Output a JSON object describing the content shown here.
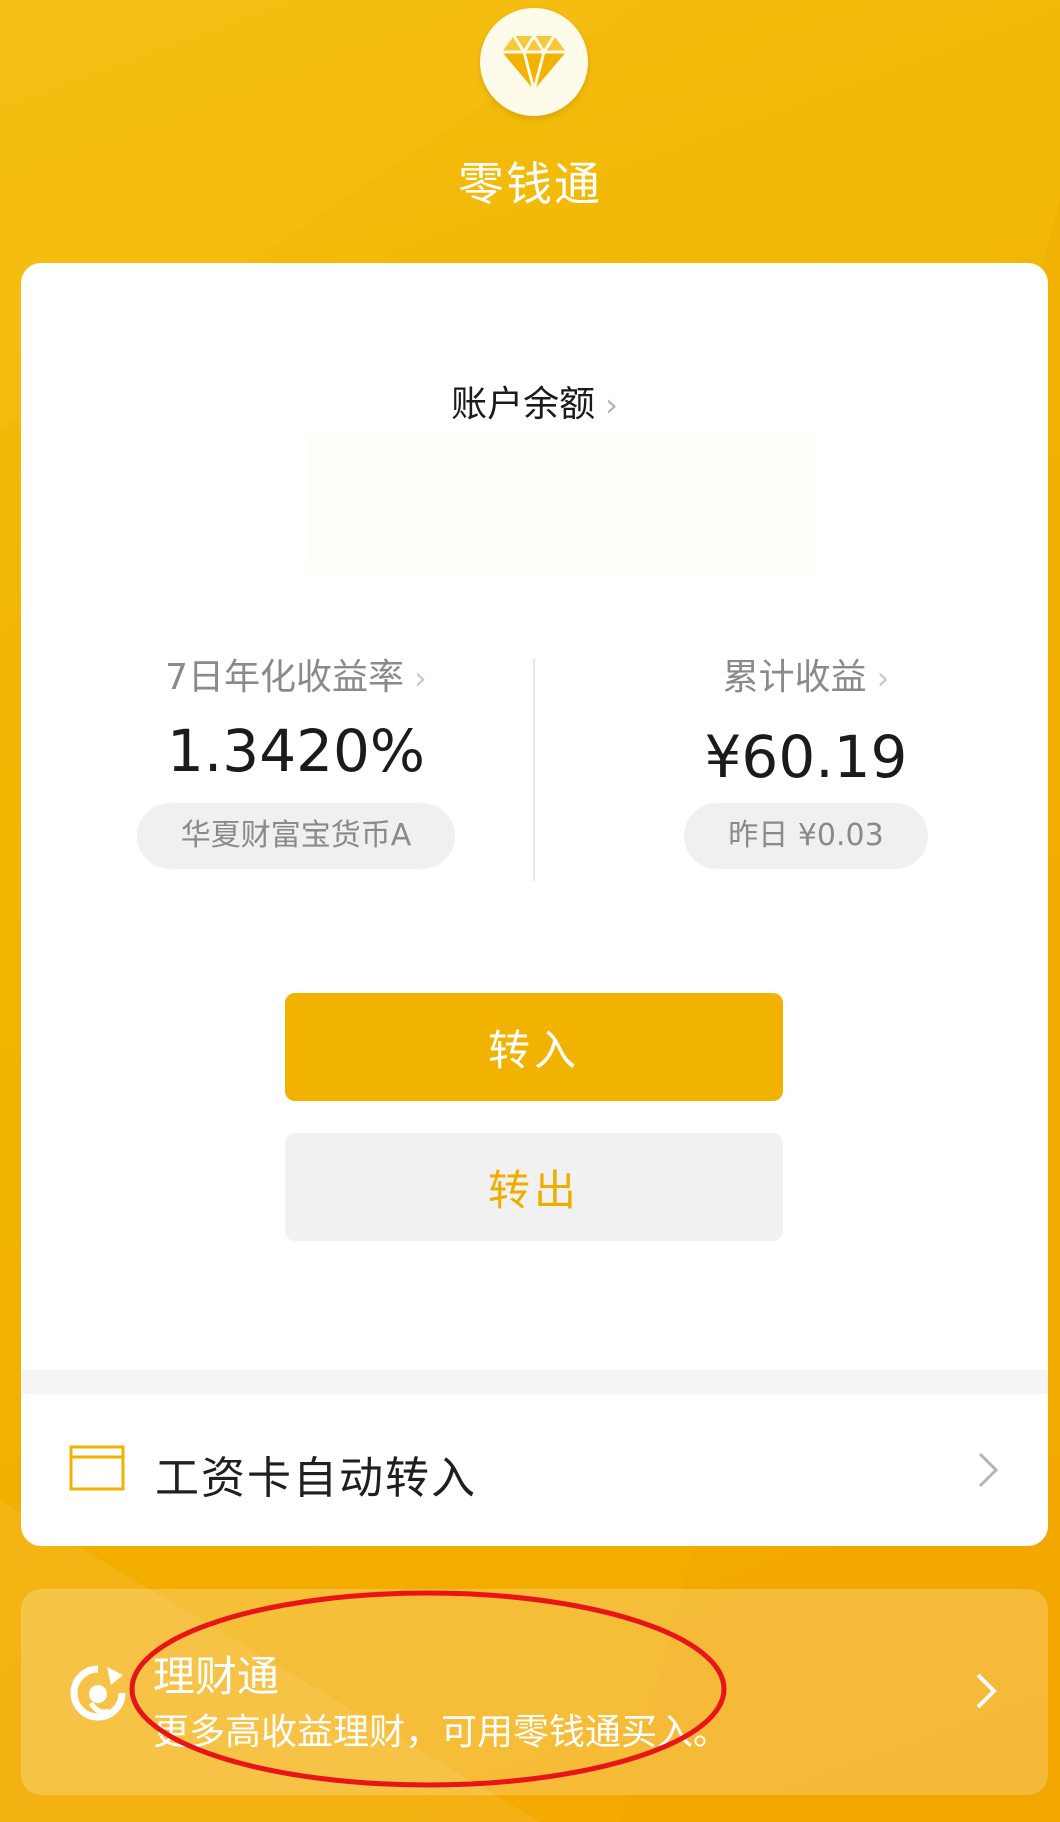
{
  "header": {
    "title": "零钱通",
    "logo_icon": "diamond-icon"
  },
  "balance": {
    "label": "账户余额",
    "chevron": "›"
  },
  "stats": {
    "yield": {
      "label": "7日年化收益率",
      "value": "1.3420%",
      "fund": "华夏财富宝货币A"
    },
    "earnings": {
      "label": "累计收益",
      "value": "¥60.19",
      "yesterday": "昨日 ¥0.03"
    }
  },
  "buttons": {
    "transfer_in": "转入",
    "transfer_out": "转出"
  },
  "salary_row": {
    "label": "工资卡自动转入",
    "icon": "card-icon"
  },
  "licai": {
    "title": "理财通",
    "subtitle": "更多高收益理财，可用零钱通买入。",
    "icon": "licaitong-icon"
  },
  "colors": {
    "brand": "#f2b300",
    "annotation": "#e8141a"
  }
}
